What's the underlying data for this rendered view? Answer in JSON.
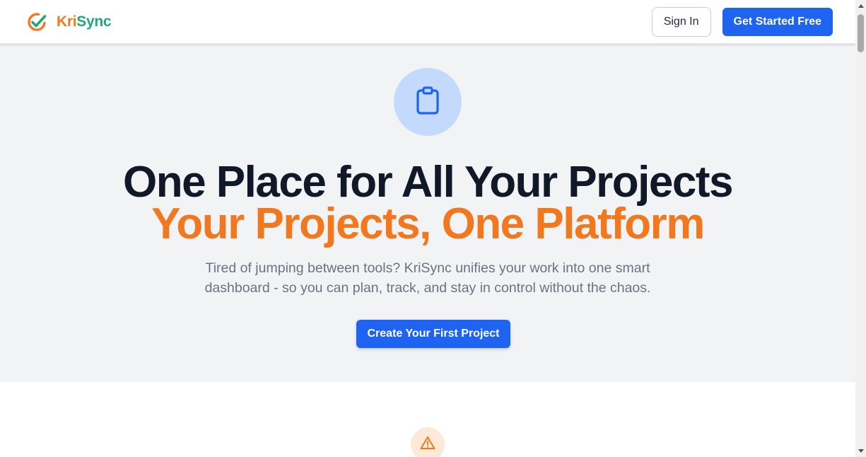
{
  "brand": {
    "name_part1": "Kri",
    "name_part2": "Sync",
    "logo_icon": "check-circle-icon",
    "colors": {
      "orange": "#f2781f",
      "green": "#1fa97a"
    }
  },
  "header": {
    "sign_in_label": "Sign In",
    "get_started_label": "Get Started Free"
  },
  "hero": {
    "icon": "clipboard-icon",
    "title": "One Place for All Your Projects",
    "subtitle": "Your Projects, One Platform",
    "description": "Tired of jumping between tools? KriSync unifies your work into one smart dashboard - so you can plan, track, and stay in control without the chaos.",
    "cta_label": "Create Your First Project"
  },
  "next_section": {
    "icon": "warning-triangle-icon"
  },
  "colors": {
    "primary": "#1f63f1",
    "accent": "#f2781f",
    "hero_background": "#f2f3f5",
    "heading": "#111827",
    "body_text": "#6b7280"
  }
}
